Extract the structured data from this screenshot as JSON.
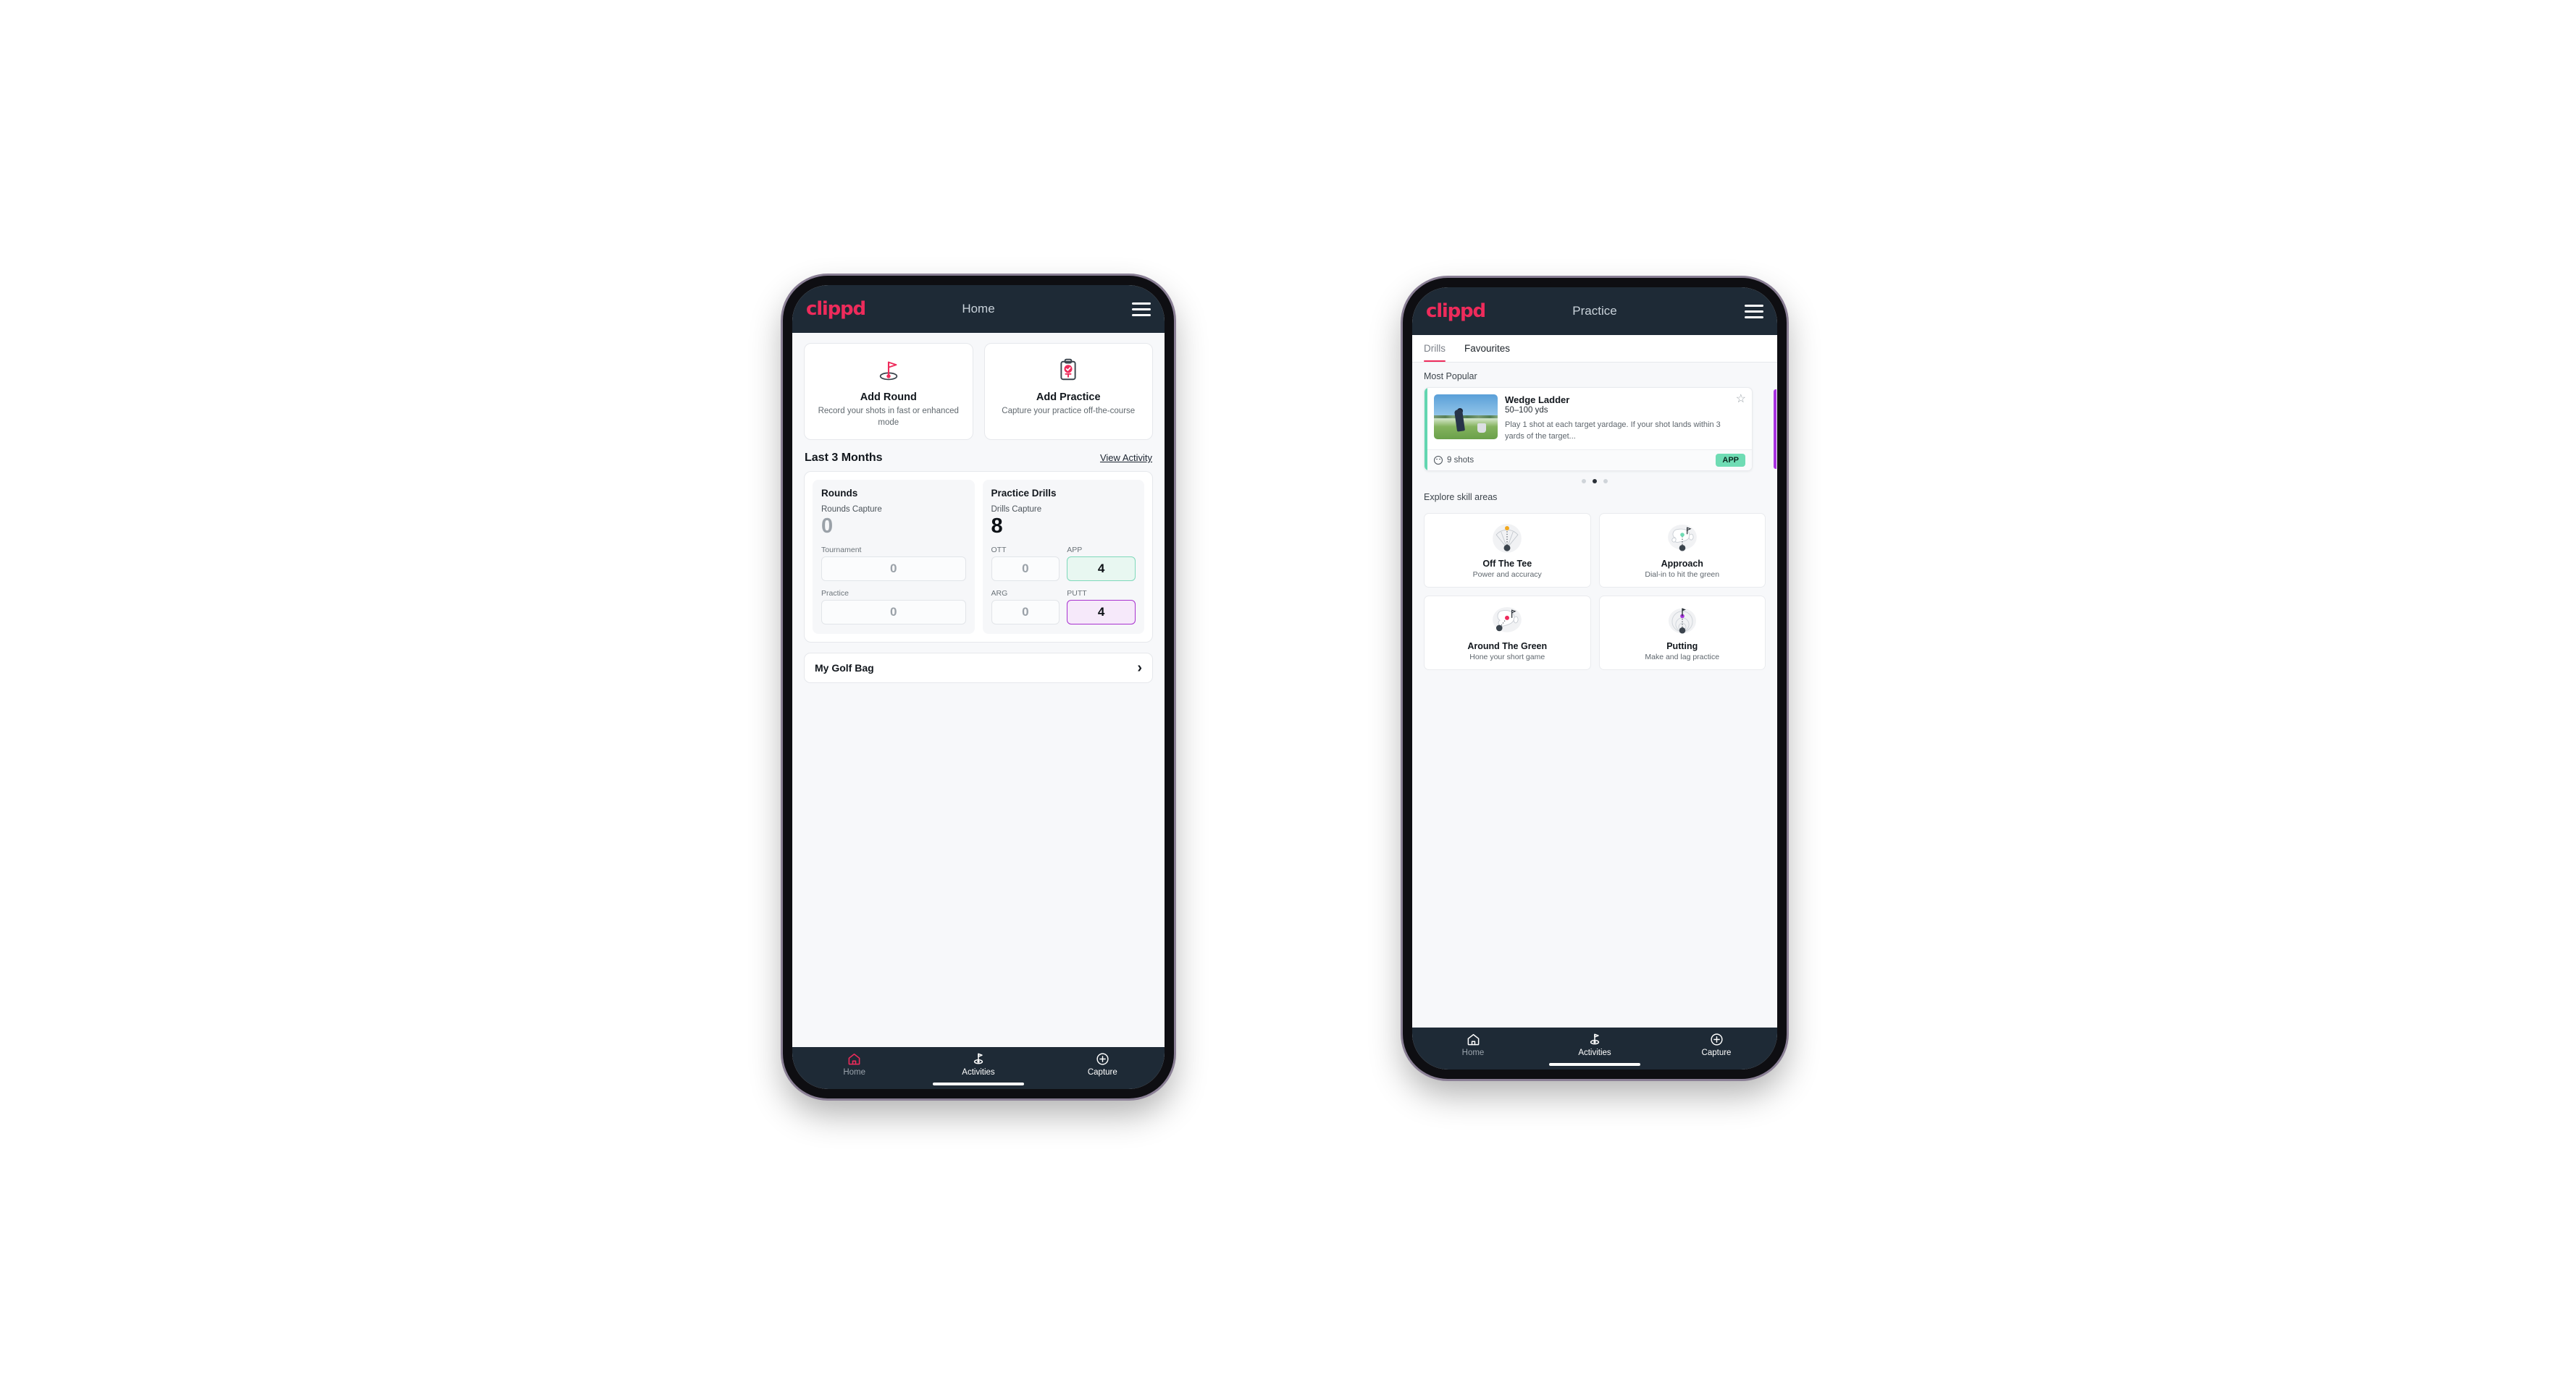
{
  "brand": "clippd",
  "colors": {
    "accent_pink": "#ee2b5b",
    "navy": "#1e2a36",
    "teal": "#6fdcb4",
    "purple": "#a832e0",
    "amber": "#f2a81d"
  },
  "home": {
    "appbar": {
      "title": "Home",
      "menu_icon": "hamburger-icon"
    },
    "quick_actions": [
      {
        "icon": "golf-flag-hole-icon",
        "title": "Add Round",
        "subtitle": "Record your shots in fast or enhanced mode"
      },
      {
        "icon": "clipboard-check-tee-icon",
        "title": "Add Practice",
        "subtitle": "Capture your practice off-the-course"
      }
    ],
    "section": {
      "title": "Last 3 Months",
      "link": "View Activity"
    },
    "rounds_panel": {
      "title": "Rounds",
      "capture_label": "Rounds Capture",
      "capture_value": "0",
      "items": [
        {
          "label": "Tournament",
          "value": "0"
        },
        {
          "label": "Practice",
          "value": "0"
        }
      ]
    },
    "drills_panel": {
      "title": "Practice Drills",
      "capture_label": "Drills Capture",
      "capture_value": "8",
      "items": [
        {
          "label": "OTT",
          "value": "0"
        },
        {
          "label": "APP",
          "value": "4"
        },
        {
          "label": "ARG",
          "value": "0"
        },
        {
          "label": "PUTT",
          "value": "4"
        }
      ]
    },
    "golf_bag": {
      "label": "My Golf Bag",
      "chevron": "chevron-right-icon"
    },
    "bottom_nav": [
      {
        "icon": "home-icon",
        "label": "Home"
      },
      {
        "icon": "golf-flag-icon",
        "label": "Activities"
      },
      {
        "icon": "plus-circle-icon",
        "label": "Capture"
      }
    ]
  },
  "practice": {
    "appbar": {
      "title": "Practice",
      "menu_icon": "hamburger-icon"
    },
    "tabs": [
      {
        "label": "Drills",
        "active": true
      },
      {
        "label": "Favourites",
        "active": false
      }
    ],
    "most_popular_label": "Most Popular",
    "drill": {
      "title": "Wedge Ladder",
      "subtitle": "50–100 yds",
      "description": "Play 1 shot at each target yardage. If your shot lands within 3 yards of the target...",
      "shots": "9 shots",
      "tag": "APP",
      "star_icon": "star-outline-icon",
      "thumbnail": "golfer-chipping-photo"
    },
    "carousel_dots": 3,
    "carousel_active_dot": 1,
    "explore_label": "Explore skill areas",
    "skills": [
      {
        "icon": "off-the-tee-icon",
        "title": "Off The Tee",
        "subtitle": "Power and accuracy"
      },
      {
        "icon": "approach-icon",
        "title": "Approach",
        "subtitle": "Dial-in to hit the green"
      },
      {
        "icon": "around-the-green-icon",
        "title": "Around The Green",
        "subtitle": "Hone your short game"
      },
      {
        "icon": "putting-icon",
        "title": "Putting",
        "subtitle": "Make and lag practice"
      }
    ],
    "bottom_nav": [
      {
        "icon": "home-icon",
        "label": "Home"
      },
      {
        "icon": "golf-flag-icon",
        "label": "Activities"
      },
      {
        "icon": "plus-circle-icon",
        "label": "Capture"
      }
    ]
  }
}
